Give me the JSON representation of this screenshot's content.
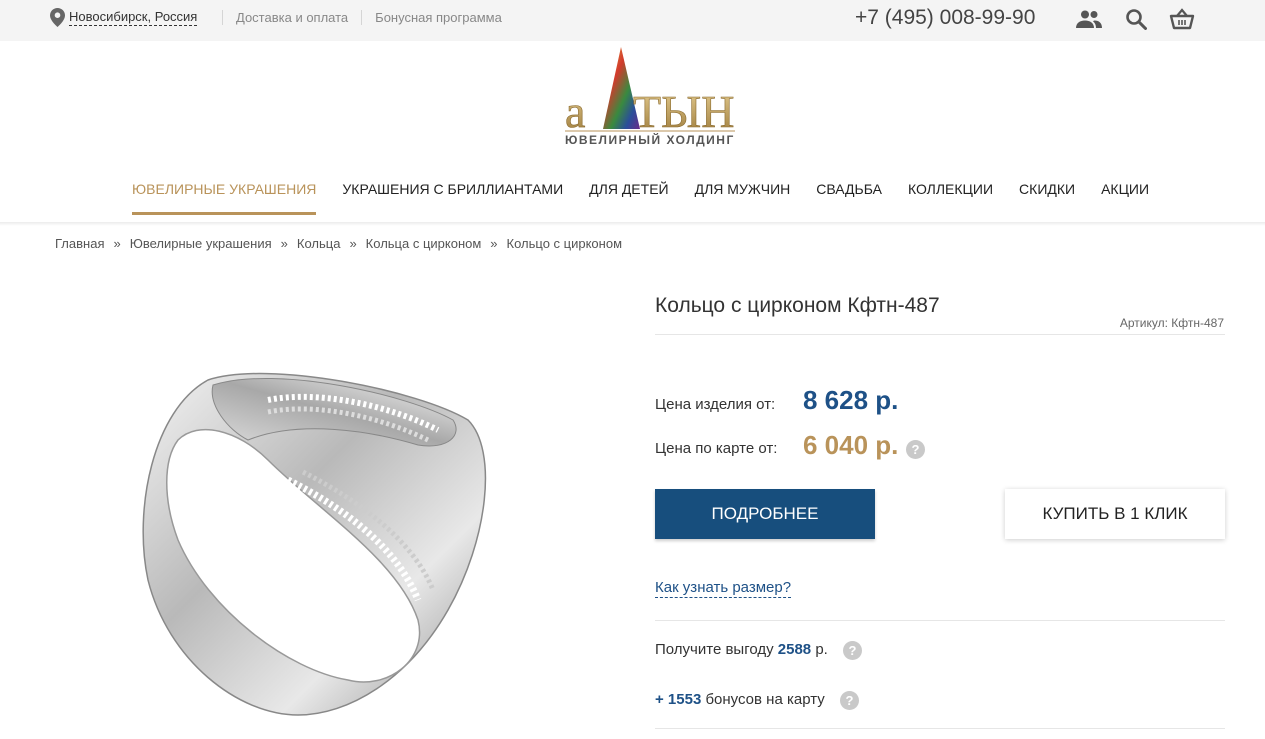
{
  "topbar": {
    "city": "Новосибирск, Россия",
    "links": [
      "Доставка и оплата",
      "Бонусная программа"
    ],
    "phone": "+7 (495) 008-99-90",
    "icons": [
      "account-icon",
      "search-icon",
      "cart-icon"
    ]
  },
  "logo": {
    "brand": "АЛТЫН",
    "subtitle": "ЮВЕЛИРНЫЙ ХОЛДИНГ"
  },
  "nav": {
    "items": [
      "ЮВЕЛИРНЫЕ УКРАШЕНИЯ",
      "УКРАШЕНИЯ С БРИЛЛИАНТАМИ",
      "ДЛЯ ДЕТЕЙ",
      "ДЛЯ МУЖЧИН",
      "СВАДЬБА",
      "КОЛЛЕКЦИИ",
      "СКИДКИ",
      "АКЦИИ"
    ],
    "active_index": 0
  },
  "breadcrumb": [
    "Главная",
    "Ювелирные украшения",
    "Кольца",
    "Кольца с цирконом",
    "Кольцо с цирконом"
  ],
  "breadcrumb_sep": "»",
  "product": {
    "title": "Кольцо с цирконом Кфтн-487",
    "sku": "Артикул: Кфтн-487",
    "price_label": "Цена изделия от:",
    "price": "8 628 р.",
    "card_price_label": "Цена по карте от:",
    "card_price": "6 040 р.",
    "btn_more": "ПОДРОБНЕЕ",
    "btn_buy": "КУПИТЬ В 1 КЛИК",
    "size_link": "Как узнать размер?",
    "benefit_prefix": "Получите выгоду ",
    "benefit_value": "2588",
    "benefit_suffix": " р.",
    "bonus_value": "+ 1553",
    "bonus_suffix": " бонусов на карту",
    "help": "?"
  },
  "colors": {
    "accent_gold": "#b9935a",
    "accent_blue": "#1e5187",
    "button_blue": "#174e7d"
  }
}
